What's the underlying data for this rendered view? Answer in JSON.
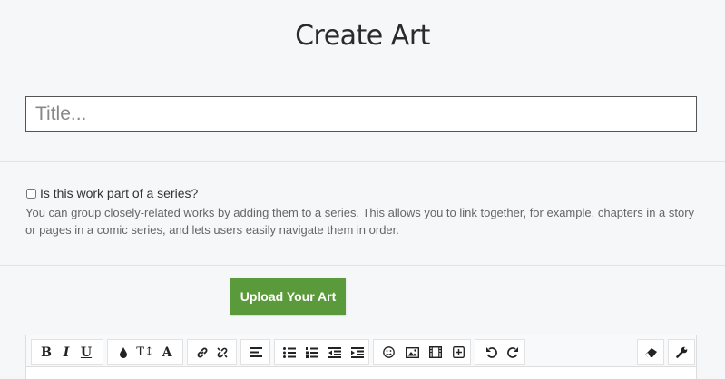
{
  "page": {
    "title": "Create Art"
  },
  "title_input": {
    "placeholder": "Title..."
  },
  "series": {
    "checked": false,
    "label": "Is this work part of a series?",
    "description": "You can group closely-related works by adding them to a series. This allows you to link together, for example, chapters in a story or pages in a comic series, and lets users easily navigate them in order."
  },
  "upload": {
    "label": "Upload Your Art",
    "color": "#5b9a3a"
  },
  "toolbar": {
    "bold": "B",
    "italic": "I",
    "underline": "U",
    "font_size": "T↕",
    "font_family": "A",
    "icons": [
      "bold",
      "italic",
      "underline",
      "text-color-icon",
      "font-size-icon",
      "font-family-icon",
      "link-icon",
      "unlink-icon",
      "align-icon",
      "bullet-list-icon",
      "numbered-list-icon",
      "outdent-icon",
      "indent-icon",
      "emoji-icon",
      "image-icon",
      "video-icon",
      "insert-more-icon",
      "undo-icon",
      "redo-icon",
      "eraser-icon",
      "wrench-icon"
    ]
  }
}
